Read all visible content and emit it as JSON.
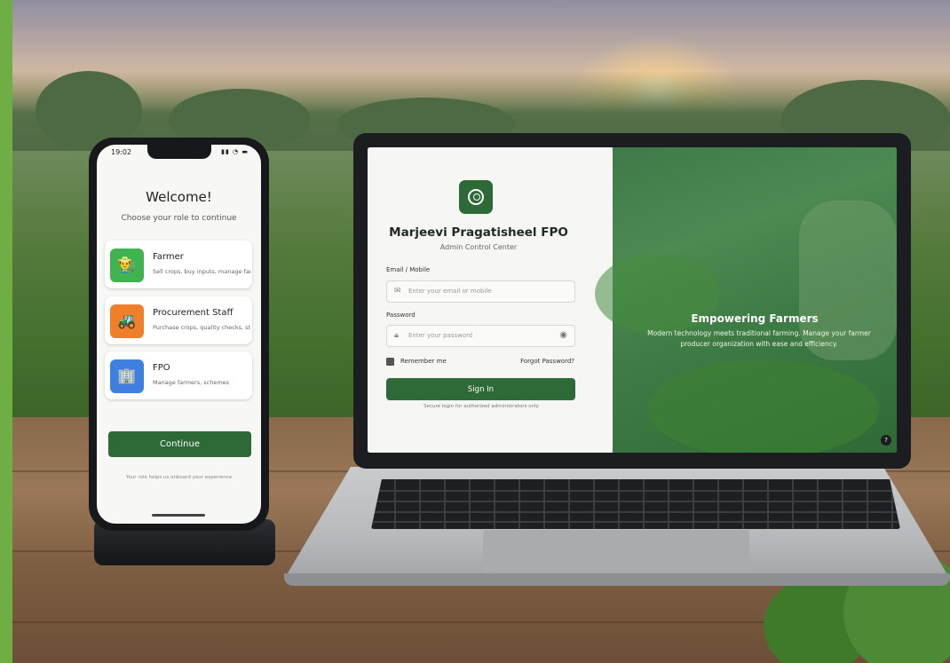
{
  "phone": {
    "status_time": "19:02",
    "status_icons": "▮▮ ◔ ▬",
    "title": "Welcome!",
    "subtitle": "Choose your role to continue",
    "roles": [
      {
        "label": "Farmer",
        "description": "Sell crops, buy inputs, manage farm",
        "icon": "farmer-icon",
        "color": "#3fb34f"
      },
      {
        "label": "Procurement Staff",
        "description": "Purchase crops, quality checks, stock",
        "icon": "tractor-icon",
        "color": "#f07f2a"
      },
      {
        "label": "FPO",
        "description": "Manage farmers, schemes",
        "icon": "building-icon",
        "color": "#3f7fe0"
      }
    ],
    "continue_label": "Continue",
    "footnote": "Your role helps us onboard your experience"
  },
  "laptop": {
    "org_name": "Marjeevi Pragatisheel FPO",
    "org_subtitle": "Admin Control Center",
    "email_label": "Email / Mobile",
    "email_placeholder": "Enter your email or mobile",
    "password_label": "Password",
    "password_placeholder": "Enter your password",
    "remember_label": "Remember me",
    "forgot_label": "Forgot Password?",
    "signin_label": "Sign In",
    "secure_note": "Secure login for authorized administrators only",
    "hero_title": "Empowering Farmers",
    "hero_text": "Modern technology meets traditional farming. Manage your farmer producer organization with ease and efficiency.",
    "help_label": "?"
  },
  "colors": {
    "brand_green": "#2e6a38",
    "accent_side_bar": "#6fae45"
  }
}
